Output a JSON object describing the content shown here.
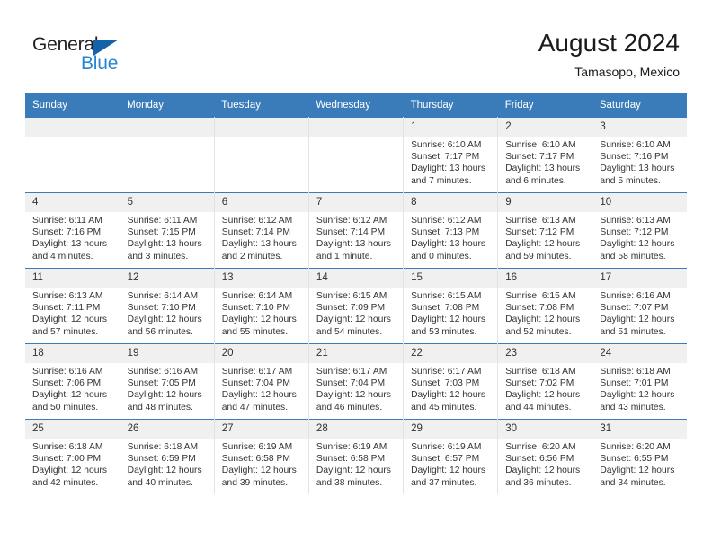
{
  "logo": {
    "word_dark": "General",
    "word_blue": "Blue",
    "triangle_color": "#1463a8",
    "blue_color": "#2386d4"
  },
  "header": {
    "title": "August 2024",
    "subtitle": "Tamasopo, Mexico"
  },
  "theme": {
    "header_blue": "#3a7cba",
    "daynum_bg": "#f0f0f0",
    "text": "#333333"
  },
  "weekdays": [
    "Sunday",
    "Monday",
    "Tuesday",
    "Wednesday",
    "Thursday",
    "Friday",
    "Saturday"
  ],
  "weeks": [
    [
      {
        "day": "",
        "empty": true,
        "sunrise": "",
        "sunset": "",
        "daylight_line1": "",
        "daylight_line2": ""
      },
      {
        "day": "",
        "empty": true,
        "sunrise": "",
        "sunset": "",
        "daylight_line1": "",
        "daylight_line2": ""
      },
      {
        "day": "",
        "empty": true,
        "sunrise": "",
        "sunset": "",
        "daylight_line1": "",
        "daylight_line2": ""
      },
      {
        "day": "",
        "empty": true,
        "sunrise": "",
        "sunset": "",
        "daylight_line1": "",
        "daylight_line2": ""
      },
      {
        "day": "1",
        "empty": false,
        "sunrise": "Sunrise: 6:10 AM",
        "sunset": "Sunset: 7:17 PM",
        "daylight_line1": "Daylight: 13 hours",
        "daylight_line2": "and 7 minutes."
      },
      {
        "day": "2",
        "empty": false,
        "sunrise": "Sunrise: 6:10 AM",
        "sunset": "Sunset: 7:17 PM",
        "daylight_line1": "Daylight: 13 hours",
        "daylight_line2": "and 6 minutes."
      },
      {
        "day": "3",
        "empty": false,
        "sunrise": "Sunrise: 6:10 AM",
        "sunset": "Sunset: 7:16 PM",
        "daylight_line1": "Daylight: 13 hours",
        "daylight_line2": "and 5 minutes."
      }
    ],
    [
      {
        "day": "4",
        "empty": false,
        "sunrise": "Sunrise: 6:11 AM",
        "sunset": "Sunset: 7:16 PM",
        "daylight_line1": "Daylight: 13 hours",
        "daylight_line2": "and 4 minutes."
      },
      {
        "day": "5",
        "empty": false,
        "sunrise": "Sunrise: 6:11 AM",
        "sunset": "Sunset: 7:15 PM",
        "daylight_line1": "Daylight: 13 hours",
        "daylight_line2": "and 3 minutes."
      },
      {
        "day": "6",
        "empty": false,
        "sunrise": "Sunrise: 6:12 AM",
        "sunset": "Sunset: 7:14 PM",
        "daylight_line1": "Daylight: 13 hours",
        "daylight_line2": "and 2 minutes."
      },
      {
        "day": "7",
        "empty": false,
        "sunrise": "Sunrise: 6:12 AM",
        "sunset": "Sunset: 7:14 PM",
        "daylight_line1": "Daylight: 13 hours",
        "daylight_line2": "and 1 minute."
      },
      {
        "day": "8",
        "empty": false,
        "sunrise": "Sunrise: 6:12 AM",
        "sunset": "Sunset: 7:13 PM",
        "daylight_line1": "Daylight: 13 hours",
        "daylight_line2": "and 0 minutes."
      },
      {
        "day": "9",
        "empty": false,
        "sunrise": "Sunrise: 6:13 AM",
        "sunset": "Sunset: 7:12 PM",
        "daylight_line1": "Daylight: 12 hours",
        "daylight_line2": "and 59 minutes."
      },
      {
        "day": "10",
        "empty": false,
        "sunrise": "Sunrise: 6:13 AM",
        "sunset": "Sunset: 7:12 PM",
        "daylight_line1": "Daylight: 12 hours",
        "daylight_line2": "and 58 minutes."
      }
    ],
    [
      {
        "day": "11",
        "empty": false,
        "sunrise": "Sunrise: 6:13 AM",
        "sunset": "Sunset: 7:11 PM",
        "daylight_line1": "Daylight: 12 hours",
        "daylight_line2": "and 57 minutes."
      },
      {
        "day": "12",
        "empty": false,
        "sunrise": "Sunrise: 6:14 AM",
        "sunset": "Sunset: 7:10 PM",
        "daylight_line1": "Daylight: 12 hours",
        "daylight_line2": "and 56 minutes."
      },
      {
        "day": "13",
        "empty": false,
        "sunrise": "Sunrise: 6:14 AM",
        "sunset": "Sunset: 7:10 PM",
        "daylight_line1": "Daylight: 12 hours",
        "daylight_line2": "and 55 minutes."
      },
      {
        "day": "14",
        "empty": false,
        "sunrise": "Sunrise: 6:15 AM",
        "sunset": "Sunset: 7:09 PM",
        "daylight_line1": "Daylight: 12 hours",
        "daylight_line2": "and 54 minutes."
      },
      {
        "day": "15",
        "empty": false,
        "sunrise": "Sunrise: 6:15 AM",
        "sunset": "Sunset: 7:08 PM",
        "daylight_line1": "Daylight: 12 hours",
        "daylight_line2": "and 53 minutes."
      },
      {
        "day": "16",
        "empty": false,
        "sunrise": "Sunrise: 6:15 AM",
        "sunset": "Sunset: 7:08 PM",
        "daylight_line1": "Daylight: 12 hours",
        "daylight_line2": "and 52 minutes."
      },
      {
        "day": "17",
        "empty": false,
        "sunrise": "Sunrise: 6:16 AM",
        "sunset": "Sunset: 7:07 PM",
        "daylight_line1": "Daylight: 12 hours",
        "daylight_line2": "and 51 minutes."
      }
    ],
    [
      {
        "day": "18",
        "empty": false,
        "sunrise": "Sunrise: 6:16 AM",
        "sunset": "Sunset: 7:06 PM",
        "daylight_line1": "Daylight: 12 hours",
        "daylight_line2": "and 50 minutes."
      },
      {
        "day": "19",
        "empty": false,
        "sunrise": "Sunrise: 6:16 AM",
        "sunset": "Sunset: 7:05 PM",
        "daylight_line1": "Daylight: 12 hours",
        "daylight_line2": "and 48 minutes."
      },
      {
        "day": "20",
        "empty": false,
        "sunrise": "Sunrise: 6:17 AM",
        "sunset": "Sunset: 7:04 PM",
        "daylight_line1": "Daylight: 12 hours",
        "daylight_line2": "and 47 minutes."
      },
      {
        "day": "21",
        "empty": false,
        "sunrise": "Sunrise: 6:17 AM",
        "sunset": "Sunset: 7:04 PM",
        "daylight_line1": "Daylight: 12 hours",
        "daylight_line2": "and 46 minutes."
      },
      {
        "day": "22",
        "empty": false,
        "sunrise": "Sunrise: 6:17 AM",
        "sunset": "Sunset: 7:03 PM",
        "daylight_line1": "Daylight: 12 hours",
        "daylight_line2": "and 45 minutes."
      },
      {
        "day": "23",
        "empty": false,
        "sunrise": "Sunrise: 6:18 AM",
        "sunset": "Sunset: 7:02 PM",
        "daylight_line1": "Daylight: 12 hours",
        "daylight_line2": "and 44 minutes."
      },
      {
        "day": "24",
        "empty": false,
        "sunrise": "Sunrise: 6:18 AM",
        "sunset": "Sunset: 7:01 PM",
        "daylight_line1": "Daylight: 12 hours",
        "daylight_line2": "and 43 minutes."
      }
    ],
    [
      {
        "day": "25",
        "empty": false,
        "sunrise": "Sunrise: 6:18 AM",
        "sunset": "Sunset: 7:00 PM",
        "daylight_line1": "Daylight: 12 hours",
        "daylight_line2": "and 42 minutes."
      },
      {
        "day": "26",
        "empty": false,
        "sunrise": "Sunrise: 6:18 AM",
        "sunset": "Sunset: 6:59 PM",
        "daylight_line1": "Daylight: 12 hours",
        "daylight_line2": "and 40 minutes."
      },
      {
        "day": "27",
        "empty": false,
        "sunrise": "Sunrise: 6:19 AM",
        "sunset": "Sunset: 6:58 PM",
        "daylight_line1": "Daylight: 12 hours",
        "daylight_line2": "and 39 minutes."
      },
      {
        "day": "28",
        "empty": false,
        "sunrise": "Sunrise: 6:19 AM",
        "sunset": "Sunset: 6:58 PM",
        "daylight_line1": "Daylight: 12 hours",
        "daylight_line2": "and 38 minutes."
      },
      {
        "day": "29",
        "empty": false,
        "sunrise": "Sunrise: 6:19 AM",
        "sunset": "Sunset: 6:57 PM",
        "daylight_line1": "Daylight: 12 hours",
        "daylight_line2": "and 37 minutes."
      },
      {
        "day": "30",
        "empty": false,
        "sunrise": "Sunrise: 6:20 AM",
        "sunset": "Sunset: 6:56 PM",
        "daylight_line1": "Daylight: 12 hours",
        "daylight_line2": "and 36 minutes."
      },
      {
        "day": "31",
        "empty": false,
        "sunrise": "Sunrise: 6:20 AM",
        "sunset": "Sunset: 6:55 PM",
        "daylight_line1": "Daylight: 12 hours",
        "daylight_line2": "and 34 minutes."
      }
    ]
  ]
}
